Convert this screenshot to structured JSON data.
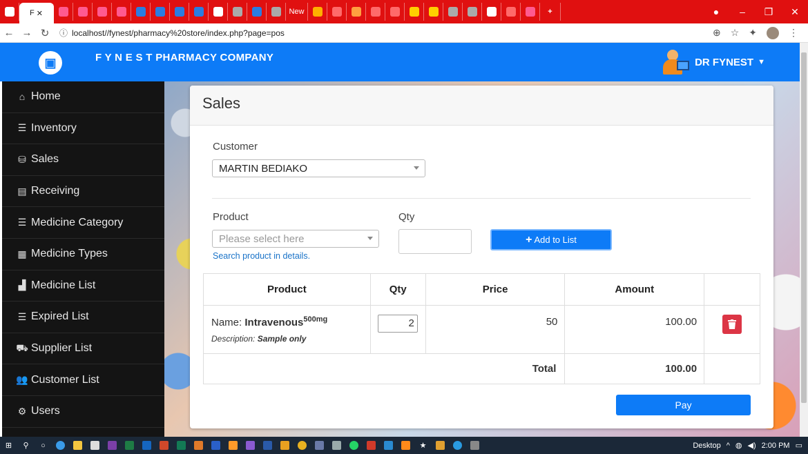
{
  "browser": {
    "active_tab_label": "F",
    "other_tab_labels": [
      "New"
    ],
    "url": "localhost//fynest/pharmacy%20store/index.php?page=pos"
  },
  "header": {
    "brand": "F Y N E S T PHARMACY COMPANY",
    "user": "DR FYNEST"
  },
  "sidebar": {
    "items": [
      {
        "label": "Home",
        "icon": "home-icon"
      },
      {
        "label": "Inventory",
        "icon": "list-icon"
      },
      {
        "label": "Sales",
        "icon": "coins-icon"
      },
      {
        "label": "Receiving",
        "icon": "file-icon"
      },
      {
        "label": "Medicine Category",
        "icon": "list-icon"
      },
      {
        "label": "Medicine Types",
        "icon": "th-list-icon"
      },
      {
        "label": "Medicine List",
        "icon": "boxes-icon"
      },
      {
        "label": "Expired List",
        "icon": "list-icon"
      },
      {
        "label": "Supplier List",
        "icon": "truck-icon"
      },
      {
        "label": "Customer List",
        "icon": "users-icon"
      },
      {
        "label": "Users",
        "icon": "users-cog-icon"
      }
    ]
  },
  "sales": {
    "title": "Sales",
    "customer_label": "Customer",
    "customer_value": "MARTIN BEDIAKO",
    "product_label": "Product",
    "product_placeholder": "Please select here",
    "qty_label": "Qty",
    "add_button": "Add to List",
    "search_link": "Search product in details.",
    "table": {
      "headers": [
        "Product",
        "Qty",
        "Price",
        "Amount"
      ],
      "rows": [
        {
          "name_prefix": "Name: ",
          "name": "Intravenous",
          "dose": "500mg",
          "desc_prefix": "Description: ",
          "desc": "Sample only",
          "qty": "2",
          "price": "50",
          "amount": "100.00"
        }
      ],
      "total_label": "Total",
      "total_value": "100.00"
    },
    "pay_button": "Pay"
  },
  "taskbar": {
    "desktop_label": "Desktop",
    "time": "2:00 PM"
  }
}
